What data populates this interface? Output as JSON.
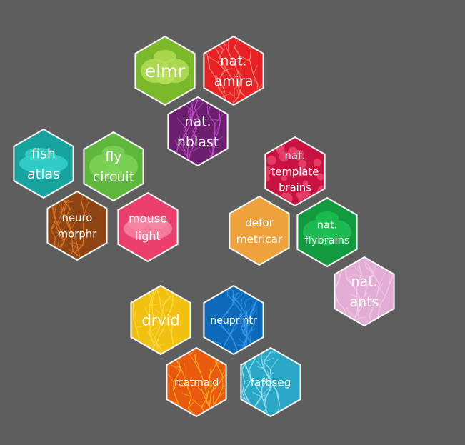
{
  "colors": {
    "background": "#5e5e5e",
    "border": "#ffffff"
  },
  "hexes": [
    {
      "id": "elmr",
      "lines": [
        "elmr"
      ],
      "fill": "#7ab929",
      "art": "brain",
      "artColor": "#b8e05a"
    },
    {
      "id": "natamira",
      "lines": [
        "nat.",
        "amira"
      ],
      "fill": "#e82224",
      "art": "neuron",
      "artColor": "#ff8a7a"
    },
    {
      "id": "natnblast",
      "lines": [
        "nat.",
        "nblast"
      ],
      "fill": "#6c1e6f",
      "art": "neuron",
      "artColor": "#c44bd0"
    },
    {
      "id": "fishatlas",
      "lines": [
        "fish",
        "atlas"
      ],
      "fill": "#17a39e",
      "art": "fish",
      "artColor": "#35d2cc"
    },
    {
      "id": "flycircuit",
      "lines": [
        "fly",
        "circuit"
      ],
      "fill": "#5db83c",
      "art": "brain",
      "artColor": "#7fd458"
    },
    {
      "id": "nattemplatebrains",
      "lines": [
        "nat.",
        "template",
        "brains"
      ],
      "fill": "#c8123f",
      "art": "dots",
      "artColor": "#ee4a73"
    },
    {
      "id": "neuromorphr",
      "lines": [
        "neuro",
        "morphr"
      ],
      "fill": "#8f4413",
      "art": "neuron",
      "artColor": "#e07a22"
    },
    {
      "id": "mouselight",
      "lines": [
        "mouse",
        "light"
      ],
      "fill": "#ea3f6c",
      "art": "mouse",
      "artColor": "#f78aa8"
    },
    {
      "id": "deformetricar",
      "lines": [
        "defor",
        "metricar"
      ],
      "fill": "#f0a23c",
      "art": "none",
      "artColor": "#f5b860"
    },
    {
      "id": "natflybrains",
      "lines": [
        "nat.",
        "flybrains"
      ],
      "fill": "#119b3e",
      "art": "brain",
      "artColor": "#1fc255"
    },
    {
      "id": "natants",
      "lines": [
        "nat.",
        "ants"
      ],
      "fill": "#e2acd4",
      "art": "neuron",
      "artColor": "#f1cfe7"
    },
    {
      "id": "drvid",
      "lines": [
        "drvid"
      ],
      "fill": "#f2c00e",
      "art": "neuron",
      "artColor": "#f9dc4a"
    },
    {
      "id": "neuprintr",
      "lines": [
        "neuprintr"
      ],
      "fill": "#0d6ab9",
      "art": "neuron",
      "artColor": "#3a9af0"
    },
    {
      "id": "rcatmaid",
      "lines": [
        "rcatmaid"
      ],
      "fill": "#ea5a0e",
      "art": "neuron",
      "artColor": "#f6b020"
    },
    {
      "id": "fafbseg",
      "lines": [
        "fafbseg"
      ],
      "fill": "#2aa7c7",
      "art": "neuron",
      "artColor": "#9ee4f4"
    }
  ]
}
